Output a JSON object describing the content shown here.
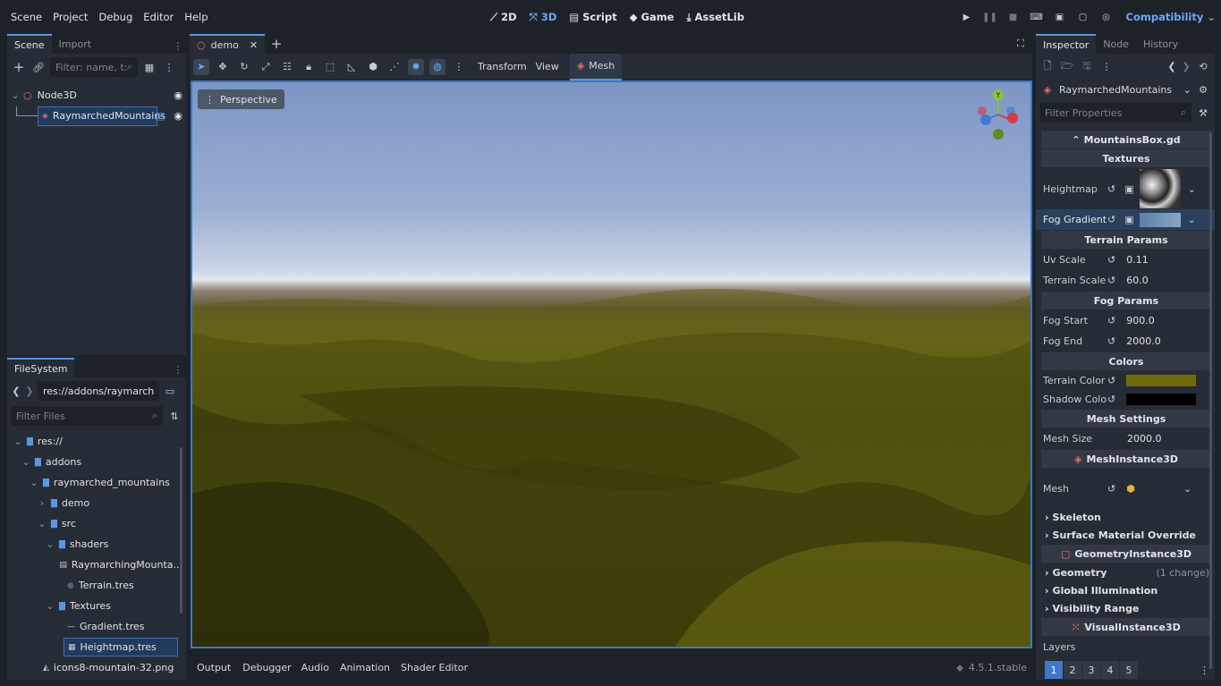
{
  "menus": [
    "Scene",
    "Project",
    "Debug",
    "Editor",
    "Help"
  ],
  "workspaces": [
    {
      "icon": "2d-icon",
      "label": "2D"
    },
    {
      "icon": "3d-icon",
      "label": "3D",
      "active": true
    },
    {
      "icon": "script-icon",
      "label": "Script"
    },
    {
      "icon": "game-icon",
      "label": "Game"
    },
    {
      "icon": "assetlib-icon",
      "label": "AssetLib"
    }
  ],
  "renderer": "Compatibility",
  "scene_dock": {
    "tabs": [
      "Scene",
      "Import"
    ],
    "filter_placeholder": "Filter: name, t:typ",
    "tree": [
      {
        "label": "Node3D",
        "icon": "node3d-icon"
      },
      {
        "label": "RaymarchedMountains",
        "icon": "mesh-icon",
        "selected": true
      }
    ]
  },
  "filesystem": {
    "tab": "FileSystem",
    "path": "res://addons/raymarched_",
    "filter_placeholder": "Filter Files",
    "items": [
      {
        "label": "res://",
        "depth": 0,
        "type": "folder"
      },
      {
        "label": "addons",
        "depth": 1,
        "type": "folder"
      },
      {
        "label": "raymarched_mountains",
        "depth": 2,
        "type": "folder"
      },
      {
        "label": "demo",
        "depth": 3,
        "type": "folder"
      },
      {
        "label": "src",
        "depth": 3,
        "type": "folder"
      },
      {
        "label": "shaders",
        "depth": 4,
        "type": "folder"
      },
      {
        "label": "RaymarchingMounta...",
        "depth": 5,
        "type": "shader"
      },
      {
        "label": "Terrain.tres",
        "depth": 5,
        "type": "material"
      },
      {
        "label": "Textures",
        "depth": 4,
        "type": "folder"
      },
      {
        "label": "Gradient.tres",
        "depth": 5,
        "type": "gradient"
      },
      {
        "label": "Heightmap.tres",
        "depth": 5,
        "type": "texture",
        "selected": true
      },
      {
        "label": "icons8-mountain-32.png",
        "depth": 2,
        "type": "image"
      }
    ]
  },
  "editor_tab": "demo",
  "toolbar": {
    "transform": "Transform",
    "view": "View",
    "mesh": "Mesh"
  },
  "viewport": {
    "perspective": "Perspective",
    "gizmo_y": "Y"
  },
  "bottom": {
    "tabs": [
      "Output",
      "Debugger",
      "Audio",
      "Animation",
      "Shader Editor"
    ],
    "version": "4.5.1.stable"
  },
  "inspector": {
    "tabs": [
      "Inspector",
      "Node",
      "History"
    ],
    "object": "RaymarchedMountains",
    "filter_placeholder": "Filter Properties",
    "script": "MountainsBox.gd",
    "textures_header": "Textures",
    "heightmap": "Heightmap",
    "fog_gradient": "Fog Gradient",
    "terrain_header": "Terrain Params",
    "uv_scale": {
      "label": "Uv Scale",
      "value": "0.11"
    },
    "terrain_scale": {
      "label": "Terrain Scale",
      "value": "60.0"
    },
    "fog_header": "Fog Params",
    "fog_start": {
      "label": "Fog Start",
      "value": "900.0"
    },
    "fog_end": {
      "label": "Fog End",
      "value": "2000.0"
    },
    "colors_header": "Colors",
    "terrain_color": {
      "label": "Terrain Color",
      "color": "#6e6a0a"
    },
    "shadow_color": {
      "label": "Shadow Colo",
      "color": "#000000"
    },
    "mesh_header": "Mesh Settings",
    "mesh_size": {
      "label": "Mesh Size",
      "value": "2000.0"
    },
    "meshinstance": "MeshInstance3D",
    "mesh": "Mesh",
    "skeleton": "Skeleton",
    "surface": "Surface Material Override",
    "geominstance": "GeometryInstance3D",
    "geometry": "Geometry",
    "geometry_change": "(1 change)",
    "gi": "Global Illumination",
    "visrange": "Visibility Range",
    "visinstance": "VisualInstance3D",
    "layers": "Layers",
    "layer_nums": [
      "1",
      "2",
      "3",
      "4",
      "5"
    ]
  },
  "colors": {
    "accent": "#5b96e0",
    "terrain": "#6e6a0a"
  }
}
